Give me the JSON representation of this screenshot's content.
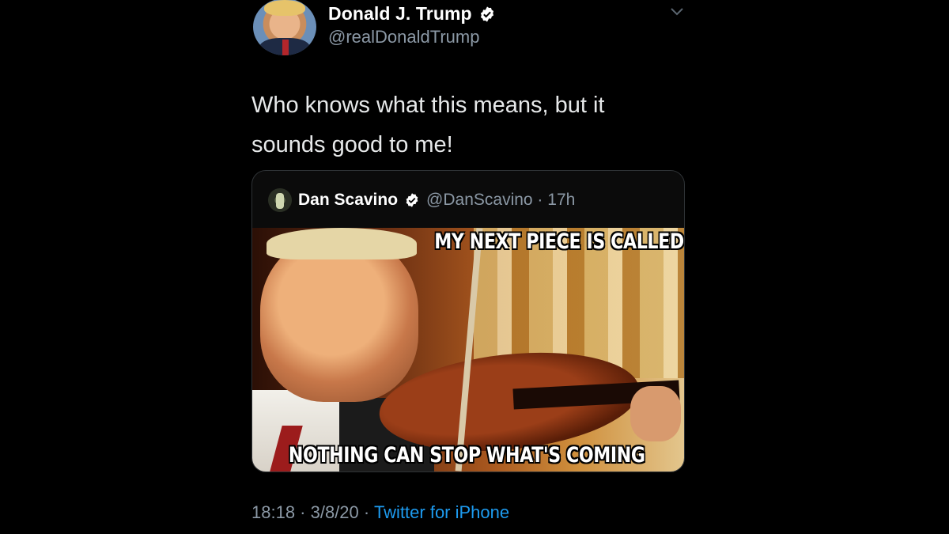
{
  "tweet": {
    "author": {
      "display_name": "Donald J. Trump",
      "handle": "@realDonaldTrump",
      "verified": true
    },
    "text_line1": "Who knows what this means, but it",
    "text_line2": "sounds good to me!",
    "quoted": {
      "display_name": "Dan Scavino",
      "handle_time": "@DanScavino · 17h",
      "verified": true,
      "meme_top_text": "MY NEXT PIECE IS CALLED",
      "meme_bottom_text": "NOTHING CAN STOP WHAT'S COMING"
    },
    "footer": {
      "time_date": "18:18 · 3/8/20 · ",
      "source": "Twitter for iPhone"
    }
  },
  "colors": {
    "background": "#000000",
    "secondary_text": "#8b98a5",
    "link": "#1d9bf0",
    "border": "#2f3336"
  },
  "icons": [
    "verified-badge-icon",
    "chevron-down-icon"
  ]
}
